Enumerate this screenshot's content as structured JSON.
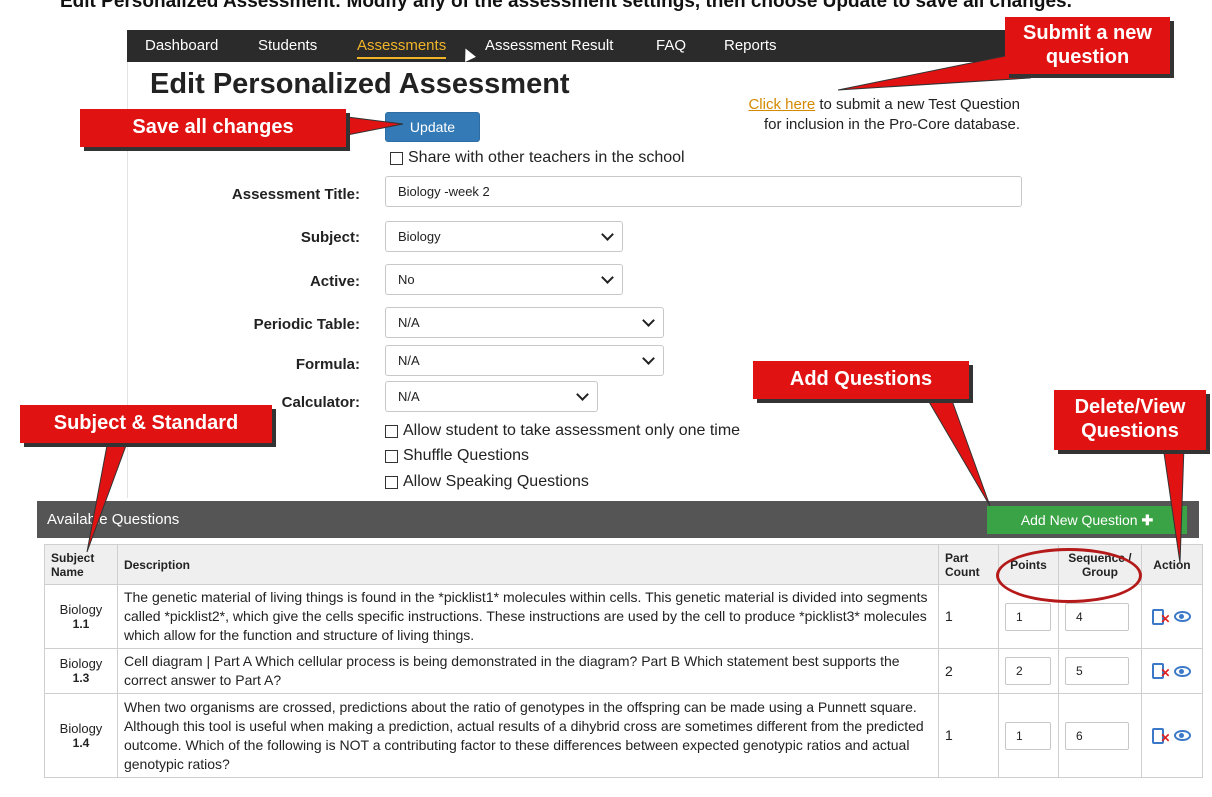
{
  "top_strip_text": "Edit Personalized Assessment: Modify any of the assessment settings, then choose Update to save all changes.",
  "nav": {
    "items": [
      "Dashboard",
      "Students",
      "Assessments",
      "Assessment Result",
      "FAQ",
      "Reports"
    ],
    "active": "Assessments"
  },
  "page_title": "Edit Personalized Assessment",
  "submit_new": {
    "link": "Click here",
    "text1": " to submit a new Test Question",
    "text2": "for inclusion in the Pro-Core database."
  },
  "update_label": "Update",
  "share_label": "Share with other teachers in the school",
  "form": {
    "title_label": "Assessment Title:",
    "title_value": "Biology -week 2",
    "subject_label": "Subject:",
    "subject_value": "Biology",
    "active_label": "Active:",
    "active_value": "No",
    "periodic_label": "Periodic Table:",
    "periodic_value": "N/A",
    "formula_label": "Formula:",
    "formula_value": "N/A",
    "calculator_label": "Calculator:",
    "calculator_value": "N/A"
  },
  "options": {
    "one_time": "Allow student to take assessment only one time",
    "shuffle": "Shuffle Questions",
    "speaking": "Allow Speaking Questions"
  },
  "table": {
    "heading": "Available Questions",
    "add_label": "Add New Question",
    "columns": {
      "subject": "Subject Name",
      "description": "Description",
      "part_count": "Part Count",
      "points": "Points",
      "sequence": "Sequence / Group",
      "action": "Action"
    },
    "rows": [
      {
        "subject": "Biology",
        "standard": "1.1",
        "description": "The genetic material of living things is found in the *picklist1* molecules within cells. This genetic material is divided into segments called *picklist2*, which give the cells specific instructions. These instructions are used by the cell to produce *picklist3* molecules which allow for the function and structure of living things.",
        "part_count": "1",
        "points": "1",
        "sequence": "4"
      },
      {
        "subject": "Biology",
        "standard": "1.3",
        "description": "Cell diagram | Part A Which cellular process is being demonstrated in the diagram? Part B Which statement best supports the correct answer to Part A?",
        "part_count": "2",
        "points": "2",
        "sequence": "5"
      },
      {
        "subject": "Biology",
        "standard": "1.4",
        "description": "When two organisms are crossed, predictions about the ratio of genotypes in the offspring can be made using a Punnett square. Although this tool is useful when making a prediction, actual results of a dihybrid cross are sometimes different from the predicted outcome. Which of the following is NOT a contributing factor to these differences between expected genotypic ratios and actual genotypic ratios?",
        "part_count": "1",
        "points": "1",
        "sequence": "6"
      }
    ]
  },
  "callouts": {
    "submit": "Submit a new question",
    "save": "Save all changes",
    "add": "Add Questions",
    "subject": "Subject & Standard",
    "delete_view": "Delete/View Questions"
  },
  "colors": {
    "callout_red": "#e01212",
    "nav_bg": "#2b2b2b",
    "active_nav": "#f0b429",
    "update_blue": "#337ab7",
    "add_green": "#3aa345"
  }
}
